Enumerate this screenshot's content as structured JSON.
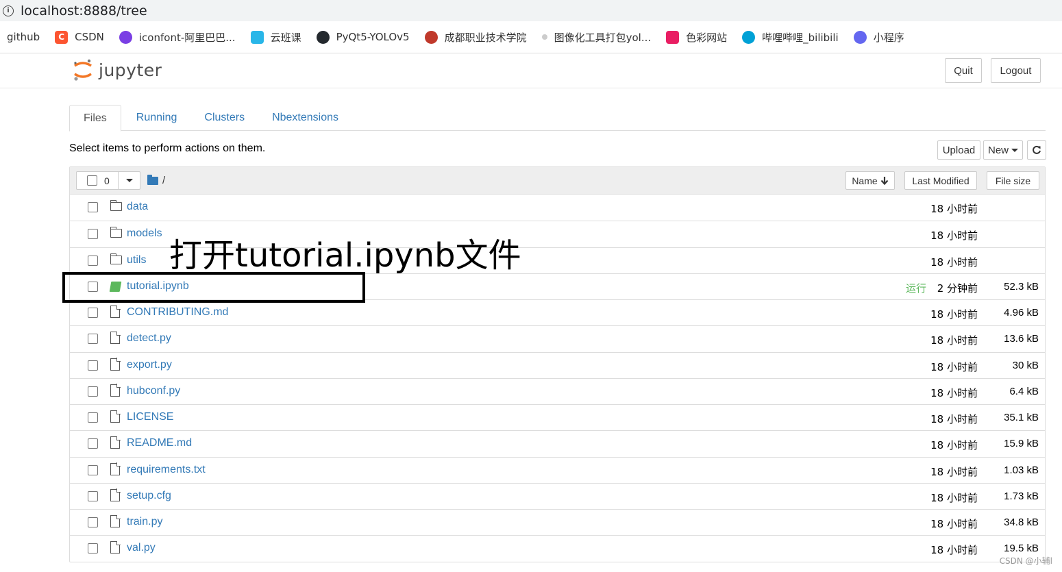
{
  "browser": {
    "url": "localhost:8888/tree",
    "bookmarks": [
      {
        "label": "github",
        "icon": "github-text-icon",
        "color": "#ffffff"
      },
      {
        "label": "CSDN",
        "icon": "csdn-icon",
        "color": "#fc5531"
      },
      {
        "label": "iconfont-阿里巴巴...",
        "icon": "iconfont-icon",
        "color": "#7a3fe4"
      },
      {
        "label": "云班课",
        "icon": "cloud-class-icon",
        "color": "#29b6e8"
      },
      {
        "label": "PyQt5-YOLOv5",
        "icon": "github-icon",
        "color": "#24292e"
      },
      {
        "label": "成都职业技术学院",
        "icon": "school-icon",
        "color": "#c0392b"
      },
      {
        "label": "图像化工具打包yol...",
        "icon": "tool-icon",
        "color": "#cccccc"
      },
      {
        "label": "色彩网站",
        "icon": "color-grid-icon",
        "color": "#e91e63"
      },
      {
        "label": "哔哩哔哩_bilibili",
        "icon": "bilibili-icon",
        "color": "#00a1d6"
      },
      {
        "label": "小程序",
        "icon": "miniprogram-icon",
        "color": "#6467f0"
      }
    ]
  },
  "header": {
    "logo_text": "jupyter",
    "quit_label": "Quit",
    "logout_label": "Logout"
  },
  "tabs": [
    {
      "label": "Files",
      "active": true
    },
    {
      "label": "Running",
      "active": false
    },
    {
      "label": "Clusters",
      "active": false
    },
    {
      "label": "Nbextensions",
      "active": false
    }
  ],
  "toolbar": {
    "select_text": "Select items to perform actions on them.",
    "upload_label": "Upload",
    "new_label": "New"
  },
  "list_header": {
    "selected_count": "0",
    "breadcrumb": "/",
    "sort_name": "Name",
    "sort_modified": "Last Modified",
    "sort_size": "File size"
  },
  "files": [
    {
      "name": "data",
      "type": "folder",
      "running": "",
      "modified": "18 小时前",
      "size": ""
    },
    {
      "name": "models",
      "type": "folder",
      "running": "",
      "modified": "18 小时前",
      "size": ""
    },
    {
      "name": "utils",
      "type": "folder",
      "running": "",
      "modified": "18 小时前",
      "size": ""
    },
    {
      "name": "tutorial.ipynb",
      "type": "notebook",
      "running": "运行",
      "modified": "2 分钟前",
      "size": "52.3 kB"
    },
    {
      "name": "CONTRIBUTING.md",
      "type": "file",
      "running": "",
      "modified": "18 小时前",
      "size": "4.96 kB"
    },
    {
      "name": "detect.py",
      "type": "file",
      "running": "",
      "modified": "18 小时前",
      "size": "13.6 kB"
    },
    {
      "name": "export.py",
      "type": "file",
      "running": "",
      "modified": "18 小时前",
      "size": "30 kB"
    },
    {
      "name": "hubconf.py",
      "type": "file",
      "running": "",
      "modified": "18 小时前",
      "size": "6.4 kB"
    },
    {
      "name": "LICENSE",
      "type": "file",
      "running": "",
      "modified": "18 小时前",
      "size": "35.1 kB"
    },
    {
      "name": "README.md",
      "type": "file",
      "running": "",
      "modified": "18 小时前",
      "size": "15.9 kB"
    },
    {
      "name": "requirements.txt",
      "type": "file",
      "running": "",
      "modified": "18 小时前",
      "size": "1.03 kB"
    },
    {
      "name": "setup.cfg",
      "type": "file",
      "running": "",
      "modified": "18 小时前",
      "size": "1.73 kB"
    },
    {
      "name": "train.py",
      "type": "file",
      "running": "",
      "modified": "18 小时前",
      "size": "34.8 kB"
    },
    {
      "name": "val.py",
      "type": "file",
      "running": "",
      "modified": "18 小时前",
      "size": "19.5 kB"
    }
  ],
  "annotation": {
    "text": "打开tutorial.ipynb文件"
  },
  "watermark": "CSDN @小辅l"
}
